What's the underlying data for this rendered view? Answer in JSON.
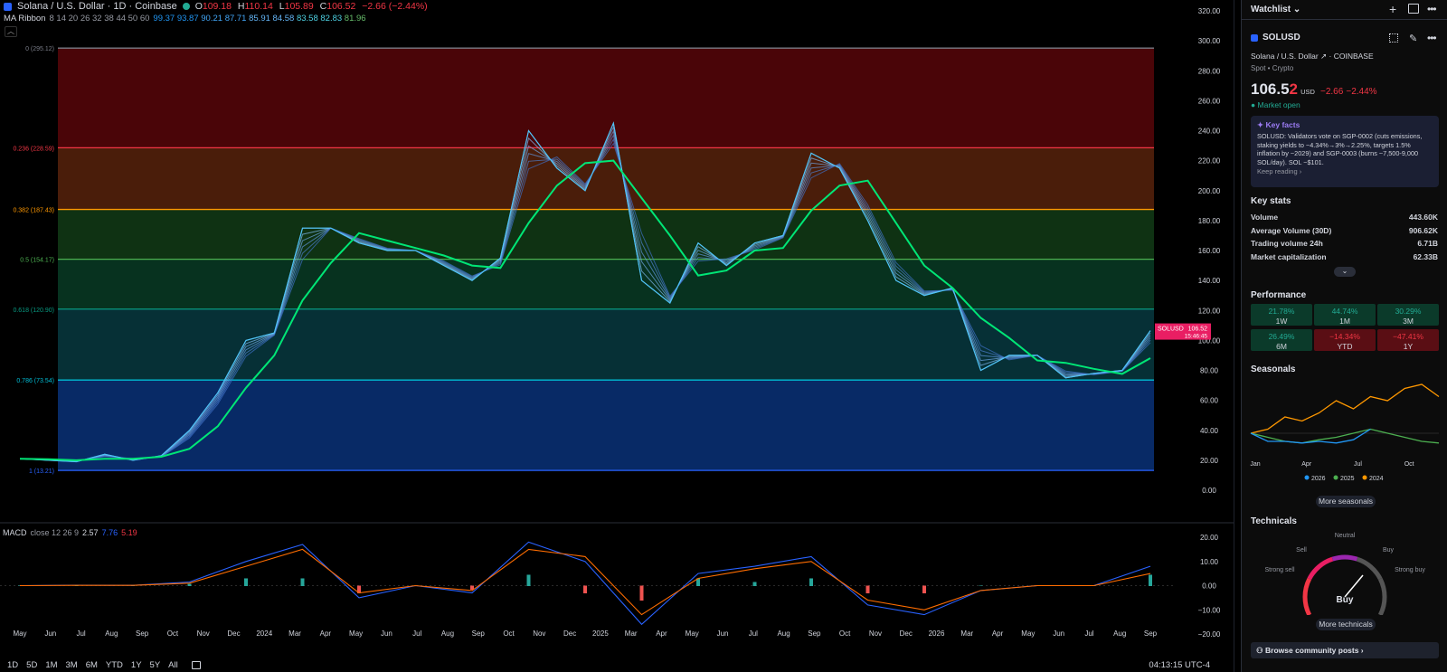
{
  "header": {
    "symbol_title": "Solana / U.S. Dollar · 1D · Coinbase",
    "open_label": "O",
    "open": "109.18",
    "high_label": "H",
    "high": "110.14",
    "low_label": "L",
    "low": "105.89",
    "close_label": "C",
    "close": "106.52",
    "change": "−2.66 (−2.44%)"
  },
  "ma_ribbon": {
    "label": "MA Ribbon",
    "params": "8 14 20 26 32 38 44 50 60",
    "values": [
      "99.37",
      "93.87",
      "90.21",
      "87.71",
      "85.91",
      "84.58",
      "83.58",
      "82.83",
      "81.96"
    ]
  },
  "fib_levels": [
    {
      "label": "0 (295.12)",
      "price": 295.12,
      "color": "#787b86"
    },
    {
      "label": "0.236 (228.59)",
      "price": 228.59,
      "color": "#f23645"
    },
    {
      "label": "0.382 (187.43)",
      "price": 187.43,
      "color": "#ff9800"
    },
    {
      "label": "0.5 (154.17)",
      "price": 154.17,
      "color": "#4caf50"
    },
    {
      "label": "0.618 (120.90)",
      "price": 120.9,
      "color": "#089981"
    },
    {
      "label": "0.786 (73.54)",
      "price": 73.54,
      "color": "#00bcd4"
    },
    {
      "label": "1 (13.21)",
      "price": 13.21,
      "color": "#2962ff"
    }
  ],
  "price_axis": [
    "320.00",
    "300.00",
    "280.00",
    "260.00",
    "240.00",
    "220.00",
    "200.00",
    "180.00",
    "160.00",
    "140.00",
    "120.00",
    "100.00",
    "80.00",
    "60.00",
    "40.00",
    "20.00",
    "0.00"
  ],
  "price_tag": {
    "symbol": "SOLUSD",
    "price": "106.52",
    "countdown": "15:46:45"
  },
  "chart_data": {
    "type": "line",
    "title": "Solana / U.S. Dollar · 1D · Coinbase",
    "x": [
      "May 2023",
      "Jun 2023",
      "Jul 2023",
      "Aug 2023",
      "Sep 2023",
      "Oct 2023",
      "Nov 2023",
      "Dec 2023",
      "2024",
      "Feb 2024",
      "Mar 2024",
      "Apr 2024",
      "May 2024",
      "Jun 2024",
      "Jul 2024",
      "Aug 2024",
      "Sep 2024",
      "Oct 2024",
      "Nov 2024",
      "Dec 2024",
      "2025",
      "Feb 2025",
      "Mar 2025",
      "Apr 2025",
      "May 2025",
      "Jun 2025",
      "Jul 2025",
      "Aug 2025",
      "Sep 2025",
      "Oct 2025",
      "Nov 2025",
      "Dec 2025",
      "2026",
      "Feb 2026",
      "Mar 2026",
      "Apr 2026",
      "May 2026",
      "Jun 2026",
      "Jul 2026",
      "Aug 2026",
      "Sep 2026"
    ],
    "series": [
      {
        "name": "SOLUSD",
        "values": [
          21,
          20,
          19,
          24,
          20,
          23,
          40,
          65,
          100,
          105,
          175,
          175,
          165,
          160,
          160,
          150,
          140,
          155,
          240,
          215,
          200,
          245,
          140,
          125,
          165,
          150,
          165,
          170,
          225,
          215,
          180,
          140,
          130,
          135,
          80,
          90,
          90,
          75,
          78,
          80,
          106.52
        ]
      }
    ],
    "ylim": [
      0,
      320
    ],
    "log_scale": false
  },
  "macd": {
    "label": "MACD",
    "params": "close 12 26 9",
    "macd_value": "2.57",
    "signal_value": "7.76",
    "hist_value": "5.19",
    "axis": [
      "20.00",
      "10.00",
      "0.00",
      "−10.00",
      "−20.00"
    ],
    "chart_data": {
      "type": "line",
      "x": [
        "May 2023",
        "Jul 2023",
        "Sep 2023",
        "Nov 2023",
        "2024",
        "Mar 2024",
        "May 2024",
        "Jul 2024",
        "Sep 2024",
        "Nov 2024",
        "2025",
        "Mar 2025",
        "May 2025",
        "Jul 2025",
        "Sep 2025",
        "Nov 2025",
        "2026",
        "Mar 2026",
        "May 2026",
        "Jul 2026",
        "Sep 2026"
      ],
      "series": [
        {
          "name": "MACD",
          "values": [
            0,
            0.2,
            0.1,
            1.5,
            10,
            17,
            -5,
            0,
            -3,
            18,
            10,
            -16,
            5,
            8,
            12,
            -8,
            -12,
            -2,
            0,
            0,
            8
          ]
        },
        {
          "name": "Signal",
          "values": [
            0,
            0.1,
            0.1,
            1,
            8,
            15,
            -3,
            0,
            -2,
            15,
            12,
            -12,
            3,
            7,
            10,
            -6,
            -10,
            -2,
            0,
            0,
            5
          ]
        }
      ],
      "ylim": [
        -22,
        22
      ]
    }
  },
  "time_axis": [
    "May",
    "Jun",
    "Jul",
    "Aug",
    "Sep",
    "Oct",
    "Nov",
    "Dec",
    "2024",
    "Mar",
    "Apr",
    "May",
    "Jun",
    "Jul",
    "Aug",
    "Sep",
    "Oct",
    "Nov",
    "Dec",
    "2025",
    "Mar",
    "Apr",
    "May",
    "Jun",
    "Jul",
    "Aug",
    "Sep",
    "Oct",
    "Nov",
    "Dec",
    "2026",
    "Mar",
    "Apr",
    "May",
    "Jun",
    "Jul",
    "Aug",
    "Sep"
  ],
  "bottom_toolbar": {
    "ranges": [
      "1D",
      "5D",
      "1M",
      "3M",
      "6M",
      "YTD",
      "1Y",
      "5Y",
      "All"
    ],
    "clock": "04:13:15 UTC-4"
  },
  "sidebar": {
    "watchlist_label": "Watchlist",
    "symbol": "SOLUSD",
    "name": "Solana / U.S. Dollar",
    "exchange": "COINBASE",
    "meta": "Spot • Crypto",
    "price_main": "106.5",
    "price_last": "2",
    "currency": "USD",
    "change": "−2.66",
    "change_pct": "−2.44%",
    "market_status": "Market open",
    "key_facts_title": "Key facts",
    "key_facts_text": "SOLUSD: Validators vote on SGP-0002 (cuts emissions, staking yields to ~4.34%→3%→2.25%, targets 1.5% inflation by ~2029) and SGP-0003 (burns ~7,500-9,000 SOL/day). SOL ~$101.",
    "keep_reading": "Keep reading ›",
    "key_stats_title": "Key stats",
    "key_stats": [
      {
        "label": "Volume",
        "value": "443.60K"
      },
      {
        "label": "Average Volume (30D)",
        "value": "906.62K"
      },
      {
        "label": "Trading volume 24h",
        "value": "6.71B"
      },
      {
        "label": "Market capitalization",
        "value": "62.33B"
      }
    ],
    "performance_title": "Performance",
    "performance": [
      {
        "value": "21.78%",
        "period": "1W",
        "sign": "pos"
      },
      {
        "value": "44.74%",
        "period": "1M",
        "sign": "pos"
      },
      {
        "value": "30.29%",
        "period": "3M",
        "sign": "pos"
      },
      {
        "value": "26.49%",
        "period": "6M",
        "sign": "pos"
      },
      {
        "value": "−14.34%",
        "period": "YTD",
        "sign": "neg"
      },
      {
        "value": "−47.41%",
        "period": "1Y",
        "sign": "neg"
      }
    ],
    "seasonals_title": "Seasonals",
    "seasonals_months": [
      "Jan",
      "Apr",
      "Jul",
      "Oct"
    ],
    "seasonals_legend": [
      {
        "label": "2026",
        "color": "#2196f3"
      },
      {
        "label": "2025",
        "color": "#4caf50"
      },
      {
        "label": "2024",
        "color": "#ff9800"
      }
    ],
    "seasonals_chart": {
      "type": "line",
      "series": [
        {
          "name": "2024",
          "values": [
            0,
            5,
            20,
            15,
            25,
            40,
            30,
            45,
            40,
            55,
            60,
            45
          ]
        },
        {
          "name": "2025",
          "values": [
            0,
            -5,
            -10,
            -12,
            -8,
            -5,
            0,
            5,
            0,
            -5,
            -10,
            -12
          ]
        },
        {
          "name": "2026",
          "values": [
            0,
            -10,
            -10,
            -12,
            -10,
            -12,
            -8,
            5
          ]
        }
      ]
    },
    "more_seasonals": "More seasonals",
    "technicals_title": "Technicals",
    "gauge_labels": {
      "neutral": "Neutral",
      "sell": "Sell",
      "buy": "Buy",
      "strong_sell": "Strong sell",
      "strong_buy": "Strong buy"
    },
    "gauge_result": "Buy",
    "more_technicals": "More technicals",
    "community": "Browse community posts ›"
  }
}
